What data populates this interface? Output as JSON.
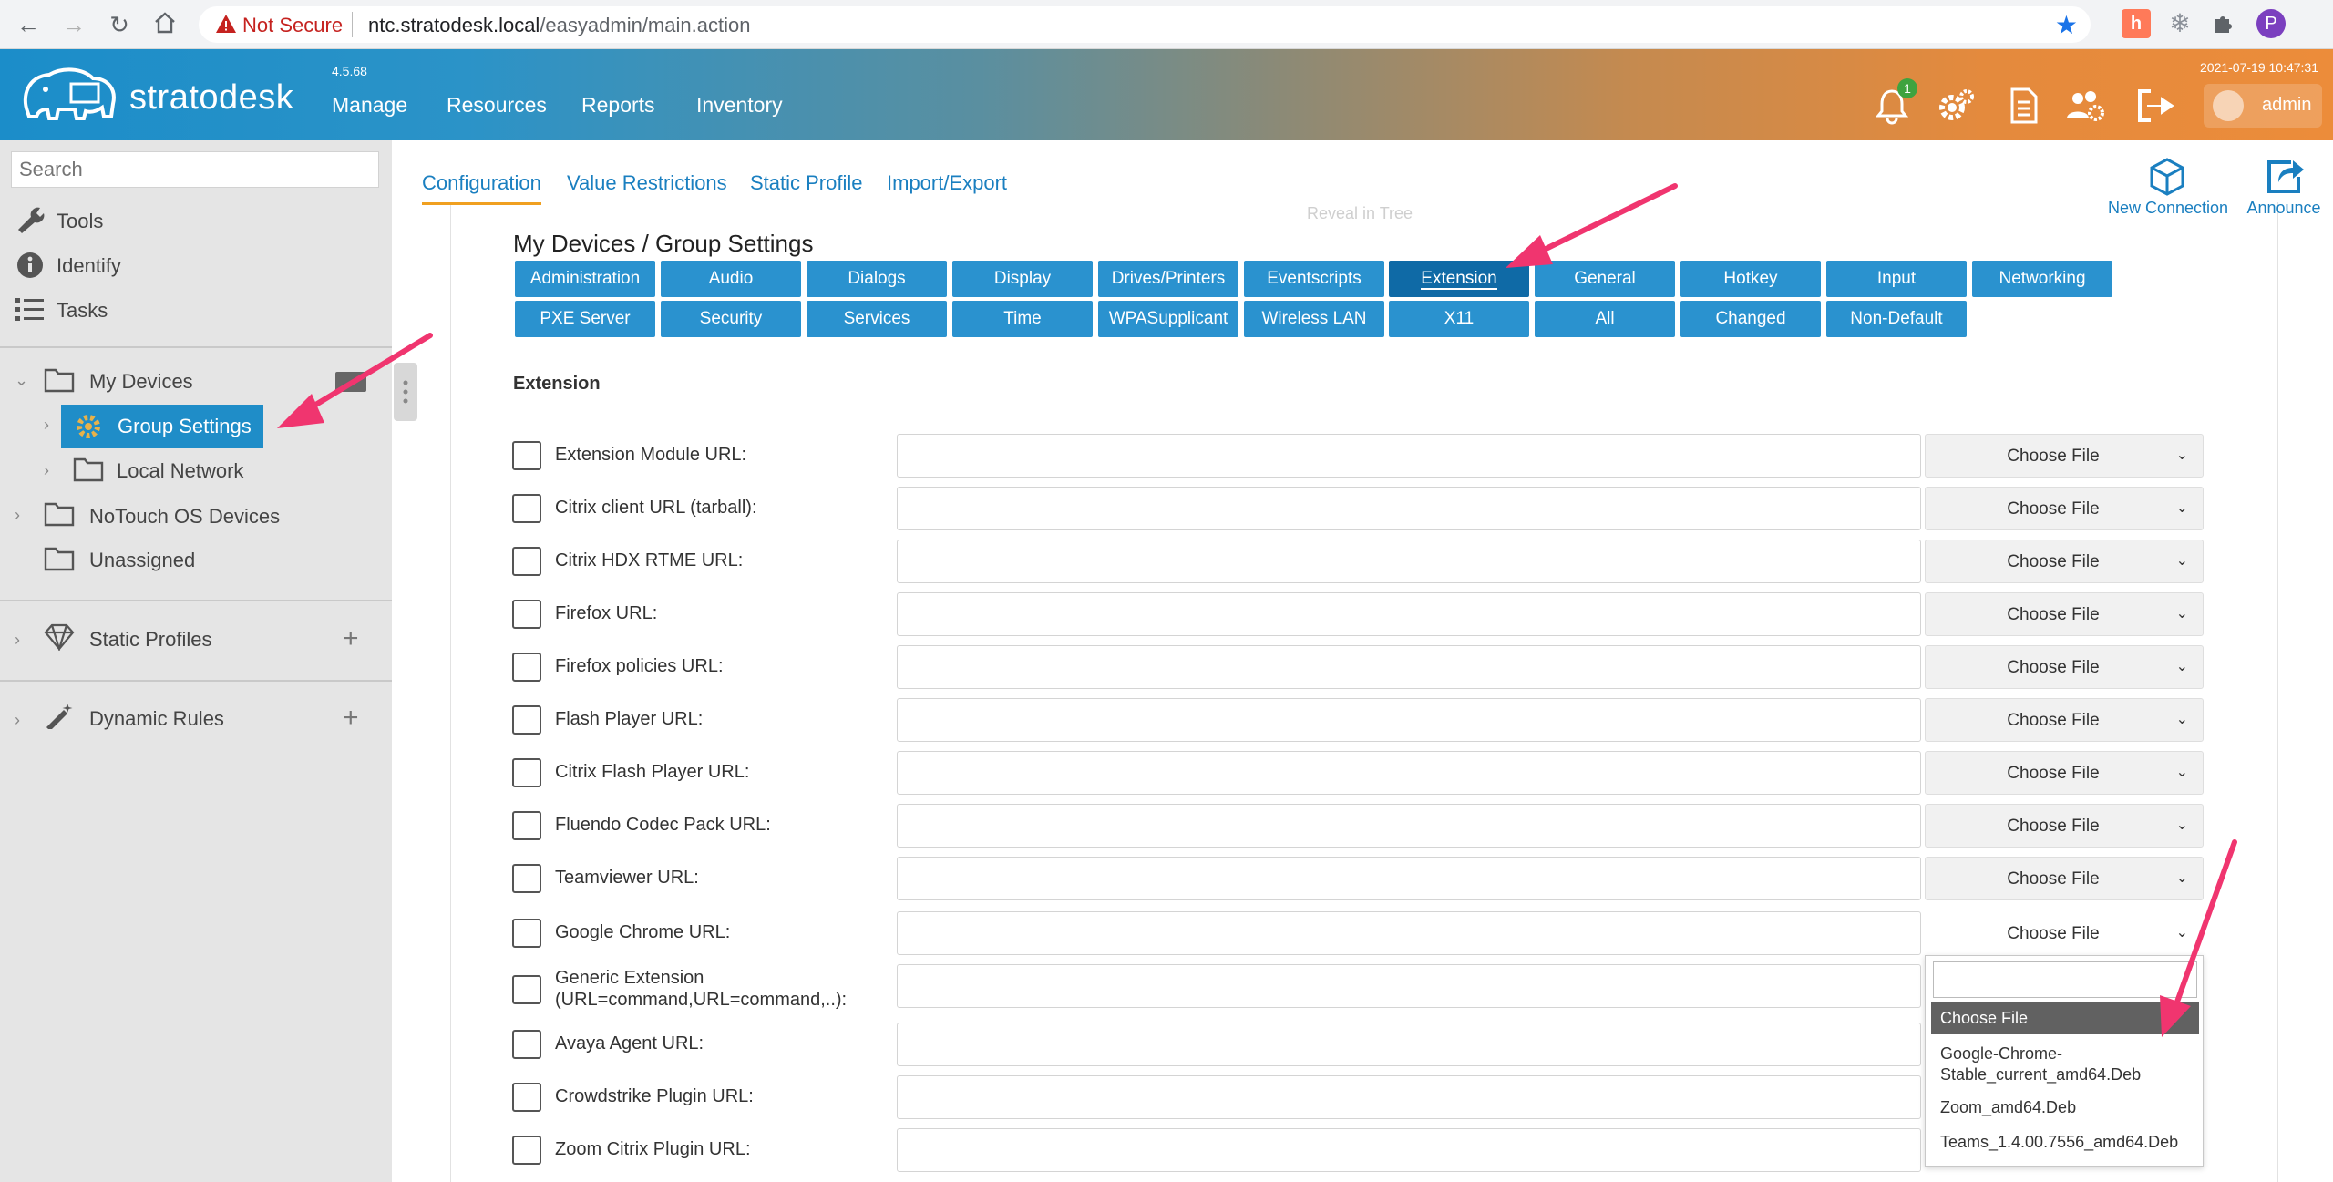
{
  "browser": {
    "not_secure": "Not Secure",
    "url_host": "ntc.stratodesk.local",
    "url_path": "/easyadmin/main.action",
    "profile_initial": "P"
  },
  "header": {
    "brand": "stratodesk",
    "version": "4.5.68",
    "nav": [
      "Manage",
      "Resources",
      "Reports",
      "Inventory"
    ],
    "timestamp": "2021-07-19 10:47:31",
    "notifications_count": "1",
    "user": "admin"
  },
  "sidebar": {
    "search_placeholder": "Search",
    "tools": [
      "Tools",
      "Identify",
      "Tasks"
    ],
    "tree": {
      "my_devices": "My Devices",
      "group_settings": "Group Settings",
      "local_network": "Local Network",
      "notouch": "NoTouch OS Devices",
      "unassigned": "Unassigned"
    },
    "static_profiles": "Static Profiles",
    "dynamic_rules": "Dynamic Rules"
  },
  "content": {
    "subtabs": [
      "Configuration",
      "Value Restrictions",
      "Static Profile",
      "Import/Export"
    ],
    "reveal": "Reveal in Tree",
    "actions": {
      "new_connection": "New Connection",
      "announce": "Announce"
    },
    "breadcrumb": "My Devices / Group Settings",
    "categories_row1": [
      "Administration",
      "Audio",
      "Dialogs",
      "Display",
      "Drives/Printers",
      "Eventscripts",
      "Extension",
      "General",
      "Hotkey",
      "Input",
      "Networking"
    ],
    "categories_row2": [
      "PXE Server",
      "Security",
      "Services",
      "Time",
      "WPASupplicant",
      "Wireless LAN",
      "X11",
      "All",
      "Changed",
      "Non-Default"
    ],
    "active_category": "Extension",
    "section_title": "Extension",
    "choose_label": "Choose File",
    "rows": [
      "Extension Module URL:",
      "Citrix client URL (tarball):",
      "Citrix HDX RTME URL:",
      "Firefox URL:",
      "Firefox policies URL:",
      "Flash Player URL:",
      "Citrix Flash Player URL:",
      "Fluendo Codec Pack URL:",
      "Teamviewer URL:",
      "Google Chrome URL:",
      "Generic Extension",
      "Avaya Agent URL:",
      "Crowdstrike Plugin URL:",
      "Zoom Citrix Plugin URL:"
    ],
    "generic_second_line": "(URL=command,URL=command,..):",
    "dropdown_options": [
      "Choose File",
      "Google-Chrome-",
      "Stable_current_amd64.Deb",
      "Zoom_amd64.Deb",
      "Teams_1.4.00.7556_amd64.Deb"
    ]
  },
  "colors": {
    "accent": "#1f8dc8",
    "active_tab": "#0f6aa6",
    "arrow": "#f0356f"
  }
}
